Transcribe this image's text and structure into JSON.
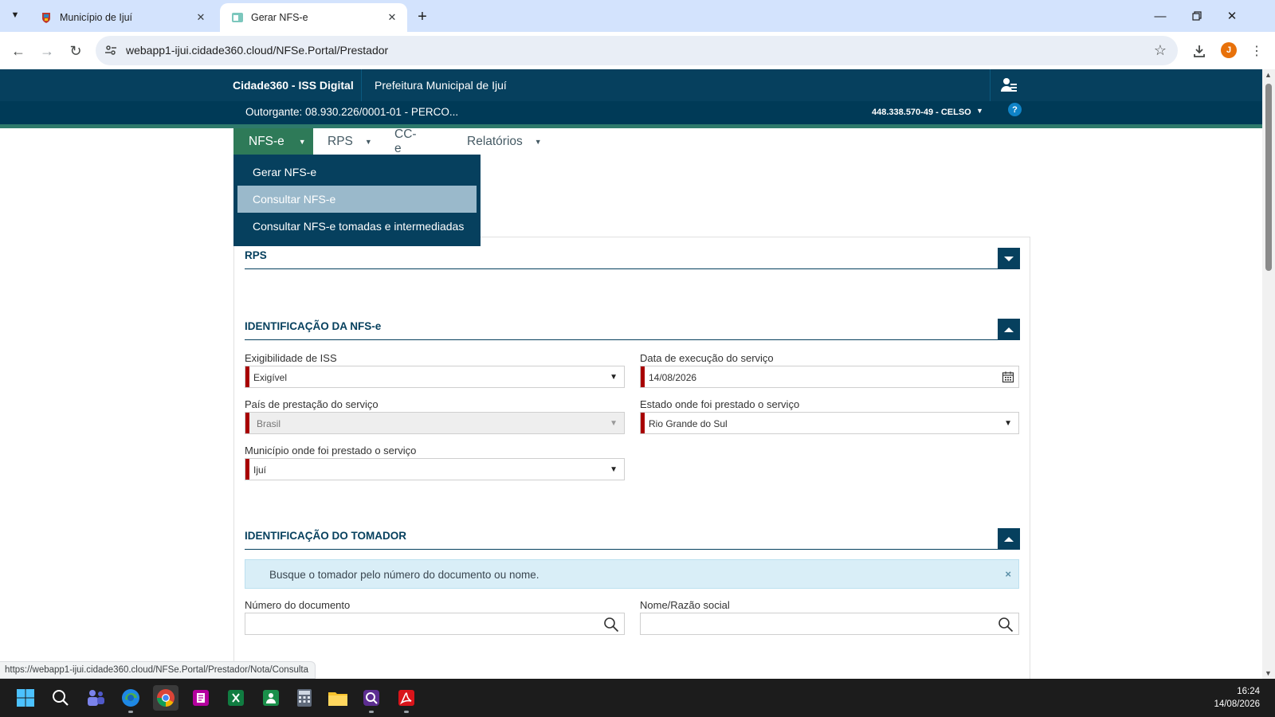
{
  "browser": {
    "tabs": [
      {
        "title": "Município de Ijuí",
        "active": false
      },
      {
        "title": "Gerar NFS-e",
        "active": true
      }
    ],
    "address": "webapp1-ijui.cidade360.cloud/NFSe.Portal/Prestador",
    "profile_initial": "J",
    "status_url": "https://webapp1-ijui.cidade360.cloud/NFSe.Portal/Prestador/Nota/Consulta"
  },
  "header": {
    "brand": "Cidade360 - ISS Digital",
    "city": "Prefeitura Municipal de Ijuí",
    "outorgante": "Outorgante: 08.930.226/0001-01 - PERCO...",
    "user": "448.338.570-49 - CELSO",
    "help": "?"
  },
  "menu": {
    "items": [
      {
        "label": "NFS-e",
        "active": true,
        "has_caret": true
      },
      {
        "label": "RPS",
        "active": false,
        "has_caret": true
      },
      {
        "label": "CC-e",
        "active": false,
        "has_caret": false
      },
      {
        "label": "Relatórios",
        "active": false,
        "has_caret": true
      }
    ],
    "dropdown": [
      {
        "label": "Gerar NFS-e",
        "hover": false
      },
      {
        "label": "Consultar NFS-e",
        "hover": true
      },
      {
        "label": "Consultar NFS-e tomadas e intermediadas",
        "hover": false
      }
    ]
  },
  "sections": {
    "rps": {
      "title": "RPS",
      "expanded": false
    },
    "identificacao_nfse": {
      "title": "IDENTIFICAÇÃO DA NFS-e",
      "expanded": true,
      "exigibilidade": {
        "label": "Exigibilidade de ISS",
        "value": "Exigível"
      },
      "data_execucao": {
        "label": "Data de execução do serviço",
        "value": "14/08/2026"
      },
      "pais": {
        "label": "País de prestação do serviço",
        "value": "Brasil",
        "disabled": true
      },
      "estado": {
        "label": "Estado onde foi prestado o serviço",
        "value": "Rio Grande do Sul"
      },
      "municipio": {
        "label": "Município onde foi prestado o serviço",
        "value": "Ijuí"
      }
    },
    "identificacao_tomador": {
      "title": "IDENTIFICAÇÃO DO TOMADOR",
      "expanded": true,
      "alert": "Busque o tomador pelo número do documento ou nome.",
      "numero_documento": {
        "label": "Número do documento",
        "value": ""
      },
      "nome": {
        "label": "Nome/Razão social",
        "value": ""
      }
    }
  },
  "taskbar": {
    "time": "16:24",
    "date": "14/08/2026",
    "apps": [
      "start-icon",
      "search-icon",
      "teams-icon",
      "edge-icon",
      "chrome-icon",
      "onenote-icon",
      "excel-icon",
      "app-icon",
      "calculator-icon",
      "file-explorer-icon",
      "app-icon",
      "acrobat-icon"
    ]
  }
}
